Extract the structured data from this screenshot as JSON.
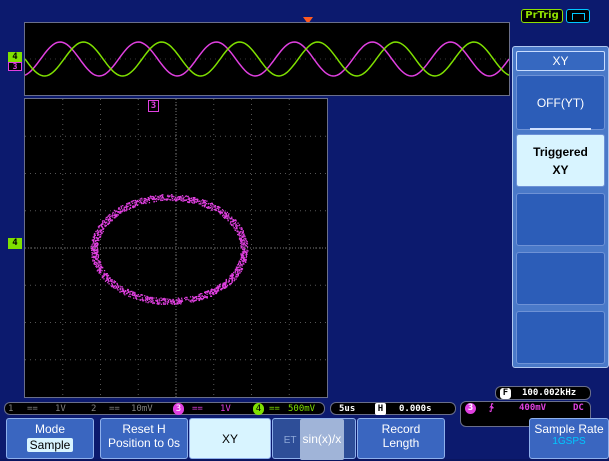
{
  "header": {
    "pretrig_label": "PrTrig",
    "trigger_status_icon": "pulse-icon"
  },
  "channel_markers": {
    "ch4_label": "4",
    "ch3_label": "3"
  },
  "menu": {
    "title": "XY",
    "items": [
      {
        "label": "OFF(YT)",
        "selected": false
      },
      {
        "label_line1": "Triggered",
        "label_line2": "XY",
        "selected": true
      },
      {
        "label": ""
      },
      {
        "label": ""
      },
      {
        "label": ""
      }
    ]
  },
  "status": {
    "ch1_num": "1",
    "ch1_coupling": "==",
    "ch1_scale": "1V",
    "ch2_num": "2",
    "ch2_coupling": "==",
    "ch2_scale": "10mV",
    "ch3_num": "3",
    "ch3_coupling": "==",
    "ch3_scale": "1V",
    "ch4_num": "4",
    "ch4_coupling": "==",
    "ch4_scale": "500mV",
    "timebase": "5us",
    "h_label": "H",
    "h_position": "0.000s",
    "freq_label": "F",
    "frequency": "100.002kHz",
    "trig_source": "3",
    "trig_slope": "∱",
    "trig_level": "400mV",
    "trig_coupling": "DC"
  },
  "softkeys": {
    "mode_line1": "Mode",
    "mode_line2": "Sample",
    "reset_line1": "Reset H",
    "reset_line2": "Position to 0s",
    "xy": "XY",
    "sinx_prefix": "ET",
    "sinx": "sin(x)/x",
    "record_line1": "Record",
    "record_line2": "Length",
    "sample_rate_line1": "Sample Rate",
    "sample_rate_line2": "1GSPS"
  },
  "colors": {
    "ch3": "#e040e0",
    "ch4": "#7fe000",
    "ch2": "#808080",
    "ch1": "#808080",
    "menu_bg": "#4a79c8",
    "selected": "#d8f4ff",
    "trigger_marker": "#ff5a20"
  }
}
